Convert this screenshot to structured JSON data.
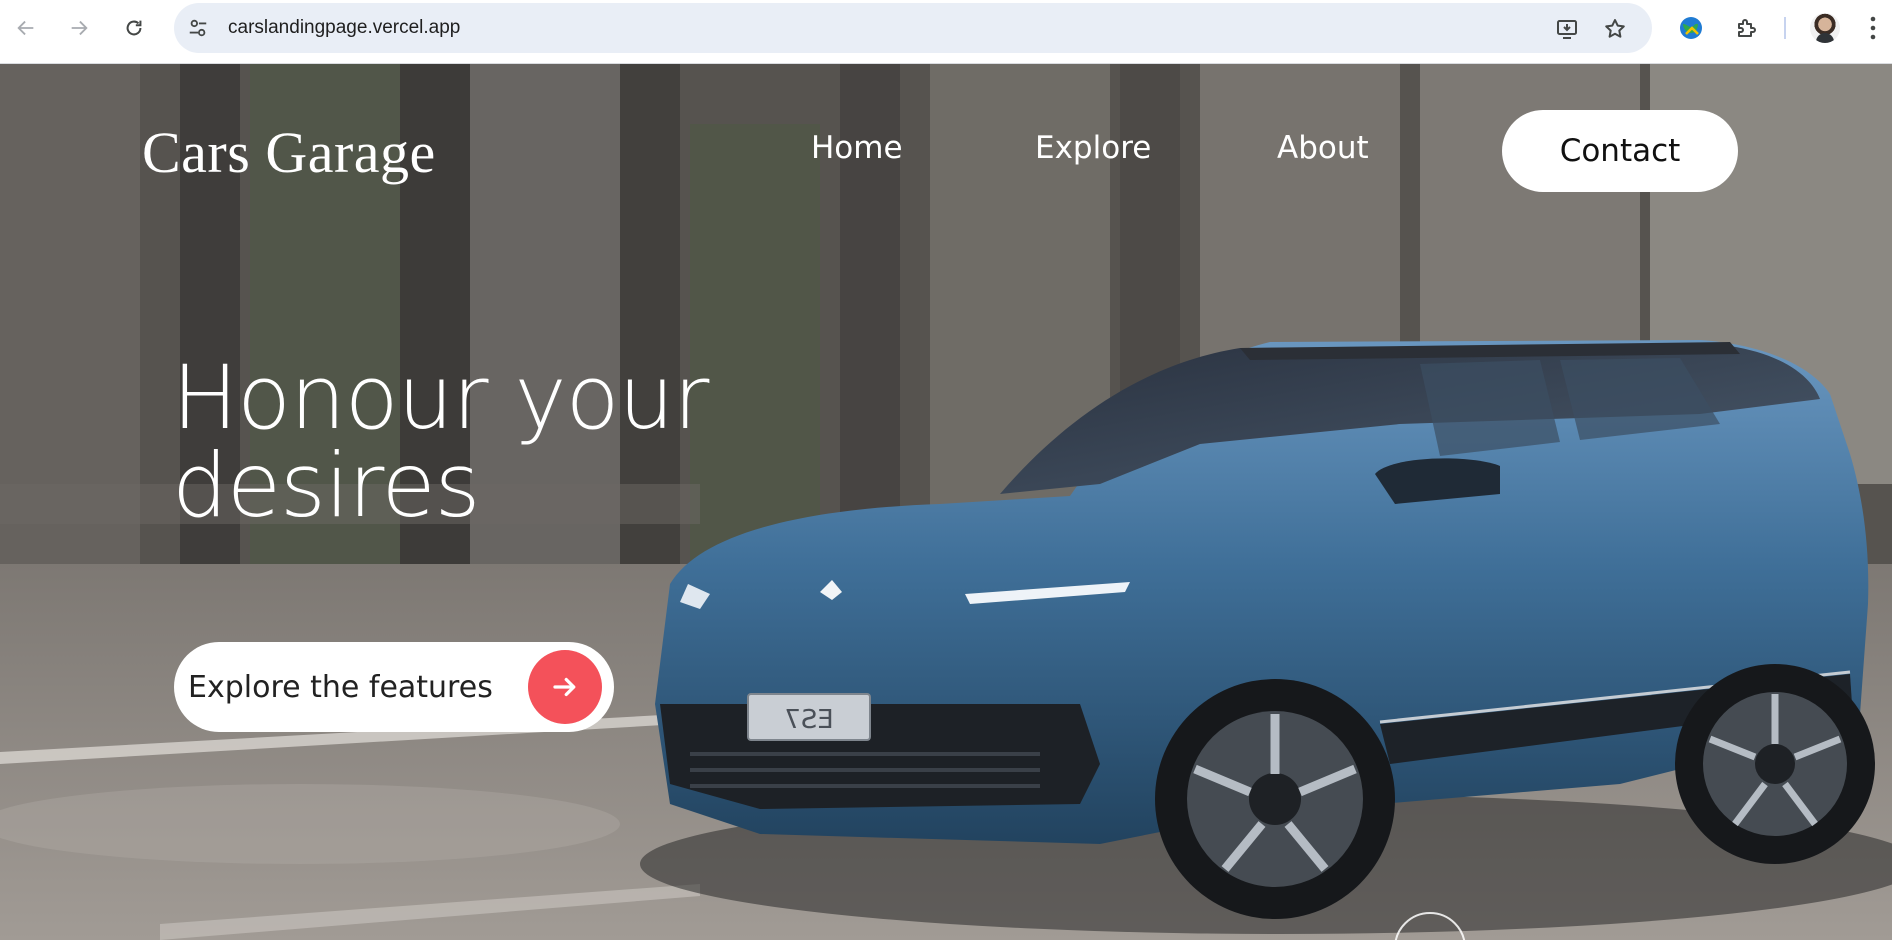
{
  "browser": {
    "url": "carslandingpage.vercel.app",
    "icons": {
      "back": "arrow-left-icon",
      "forward": "arrow-right-icon",
      "reload": "reload-icon",
      "site_info": "tune-icon",
      "install": "install-app-icon",
      "bookmark": "star-icon",
      "extension_globe": "globe-extension-icon",
      "extensions": "puzzle-icon",
      "menu": "kebab-menu-icon"
    }
  },
  "page": {
    "logo": "Cars Garage",
    "nav": [
      {
        "label": "Home"
      },
      {
        "label": "Explore"
      },
      {
        "label": "About"
      }
    ],
    "contact_label": "Contact",
    "headline_line1": "Honour your",
    "headline_line2": "desires",
    "cta_label": "Explore the features",
    "colors": {
      "accent": "#f4515a",
      "car_body": "#3f6f98",
      "text": "#ffffff"
    }
  }
}
